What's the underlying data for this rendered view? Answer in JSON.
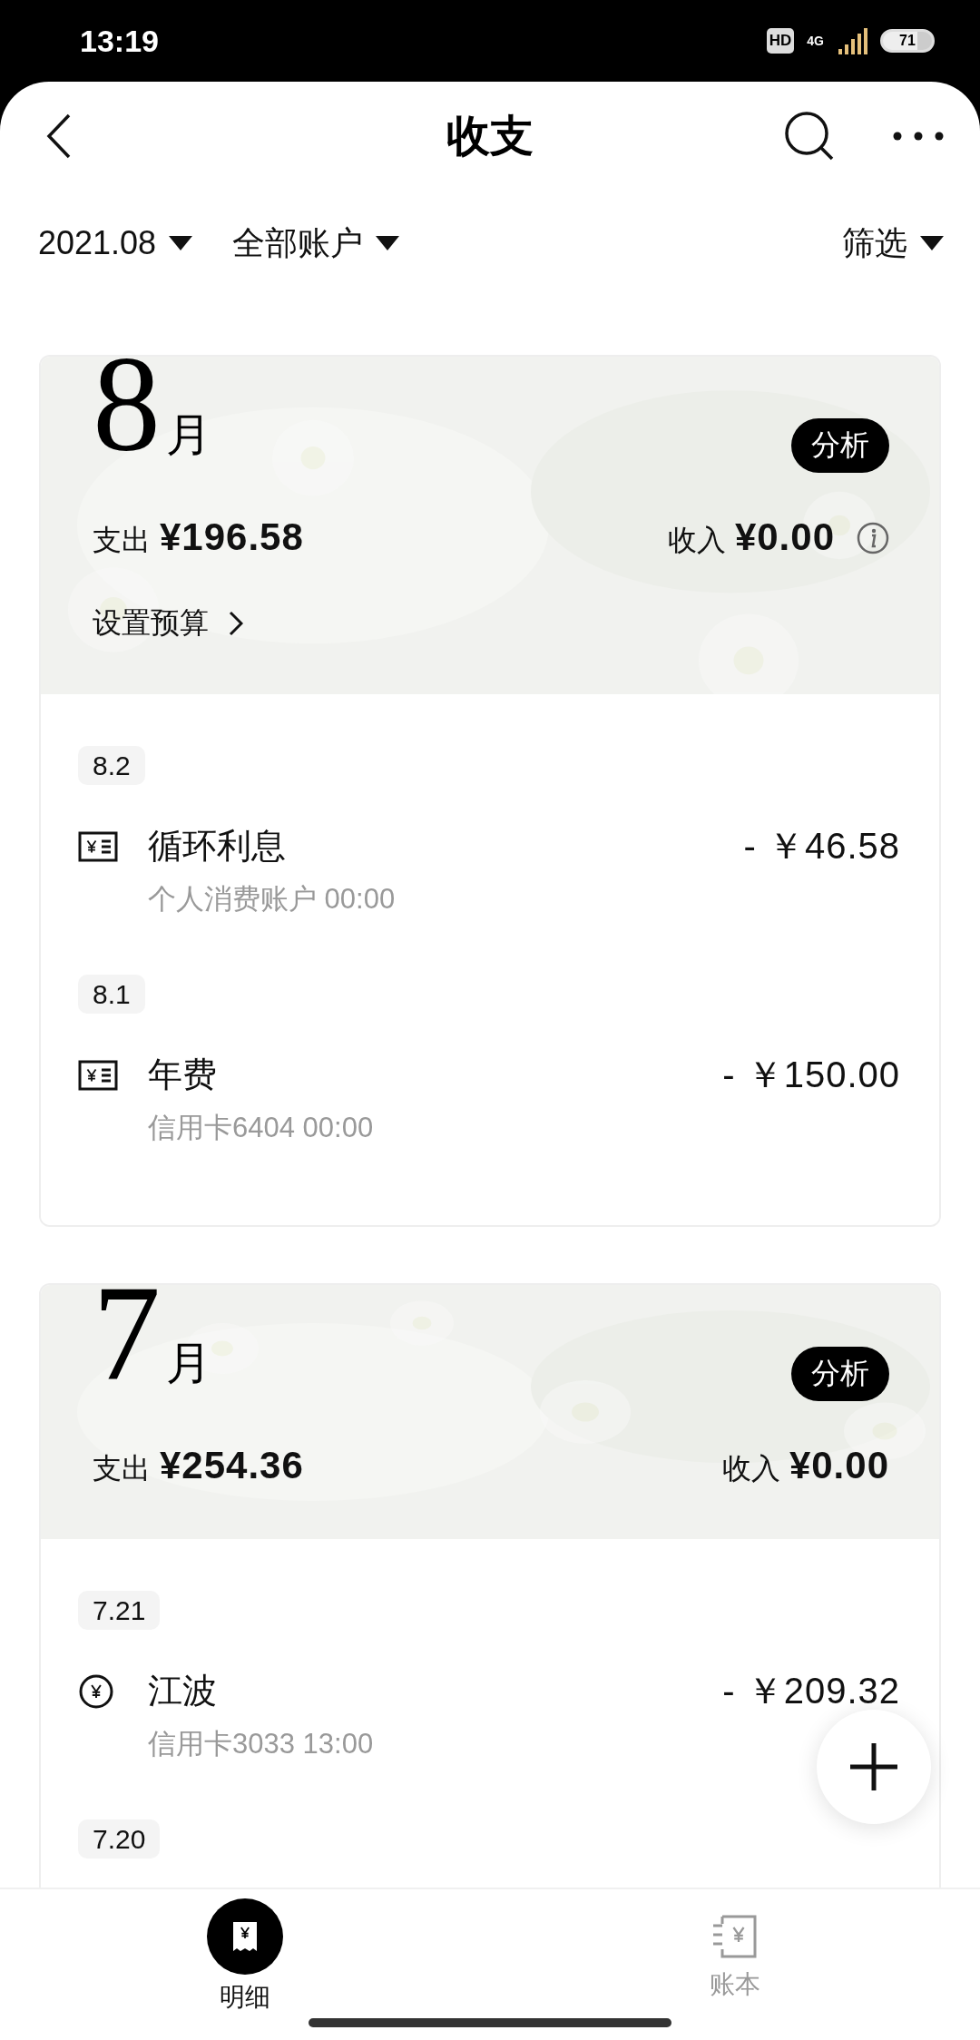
{
  "status_bar": {
    "time": "13:19",
    "hd": "HD",
    "network": "4G",
    "battery": "71"
  },
  "header": {
    "title": "收支"
  },
  "filters": [
    {
      "label": "2021.08",
      "kind": "left"
    },
    {
      "label": "全部账户",
      "kind": "left"
    },
    {
      "label": "筛选",
      "kind": "right"
    }
  ],
  "months": [
    {
      "month": "8",
      "unit": "月",
      "photo": {
        "kind": "picture"
      },
      "analyze": "分析",
      "expense_label": "支出",
      "expense": "¥196.58",
      "income_label": "收入",
      "income": "¥0.00",
      "info": true,
      "budget": "设置预算",
      "days": [
        {
          "date": "8.2",
          "items": [
            {
              "kind": "bill",
              "title": "循环利息",
              "sub": "个人消费账户 00:00",
              "amount": "- ￥46.58"
            }
          ]
        },
        {
          "date": "8.1",
          "items": [
            {
              "kind": "bill",
              "title": "年费",
              "sub": "信用卡6404 00:00",
              "amount": "- ￥150.00"
            }
          ]
        }
      ]
    },
    {
      "month": "7",
      "unit": "月",
      "photo": {
        "kind": "picture"
      },
      "analyze": "分析",
      "expense_label": "支出",
      "expense": "¥254.36",
      "income_label": "收入",
      "income": "¥0.00",
      "info": false,
      "days": [
        {
          "date": "7.21",
          "items": [
            {
              "kind": "coin",
              "title": "江波",
              "sub": "信用卡3033 13:00",
              "amount": "- ￥209.32"
            }
          ]
        },
        {
          "date": "7.20"
        }
      ]
    }
  ],
  "nav": [
    {
      "label": "明细",
      "kind": "detail",
      "selected": true
    },
    {
      "label": "账本",
      "kind": "book",
      "selected": false
    }
  ]
}
